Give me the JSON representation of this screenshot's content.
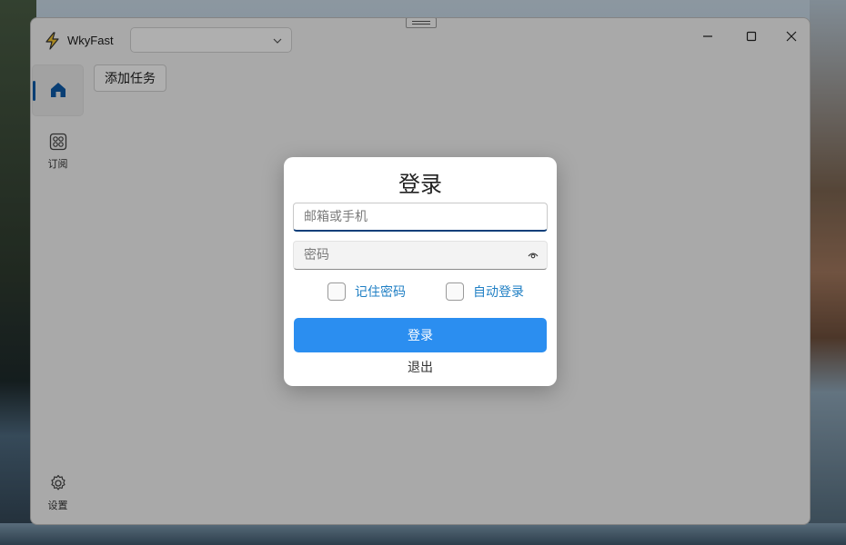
{
  "app": {
    "title": "WkyFast",
    "combo_value": ""
  },
  "toolbar": {
    "add_task_label": "添加任务"
  },
  "nav": {
    "subscribe_label": "订阅",
    "settings_label": "设置"
  },
  "login_dialog": {
    "title": "登录",
    "email_placeholder": "邮箱或手机",
    "email_value": "",
    "password_placeholder": "密码",
    "password_value": "",
    "remember_label": "记住密码",
    "remember_checked": false,
    "auto_login_label": "自动登录",
    "auto_login_checked": false,
    "login_button_label": "登录",
    "exit_label": "退出"
  },
  "colors": {
    "accent": "#2b8ef0",
    "link": "#1f7fc4",
    "nav_indicator": "#0e5aa7"
  },
  "icons": [
    "lightning-icon",
    "chevron-down-icon",
    "minimize-icon",
    "maximize-icon",
    "close-icon",
    "home-icon",
    "subscribe-grid-icon",
    "gear-icon",
    "eye-icon"
  ]
}
